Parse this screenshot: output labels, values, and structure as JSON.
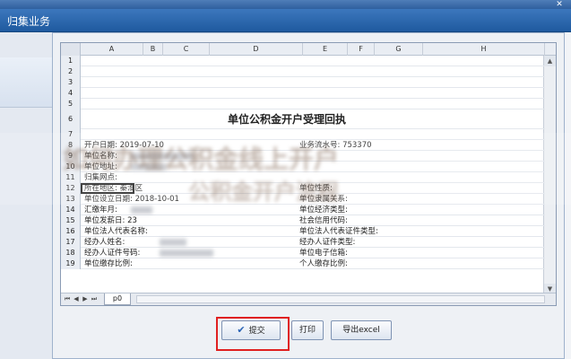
{
  "window": {
    "tab_title": "归集业务"
  },
  "sheet": {
    "columns": [
      "A",
      "B",
      "C",
      "D",
      "E",
      "F",
      "G",
      "H"
    ],
    "row_numbers": [
      "1",
      "2",
      "3",
      "4",
      "5",
      "6",
      "7",
      "8",
      "9",
      "10",
      "11",
      "12",
      "13",
      "14",
      "15",
      "16",
      "17",
      "18",
      "19"
    ],
    "title": "单位公积金开户受理回执",
    "fields": {
      "r8_left": "开户日期:   2019-07-10",
      "r8_right": "业务流水号: 753370",
      "r9_left": "单位名称:",
      "r10_left": "单位地址:",
      "r11_left": "归集网点:",
      "r12_left": "所在地区:   秦淮区",
      "r12_right": "单位性质:",
      "r13_left": "单位设立日期:   2018-10-01",
      "r13_right": "单位隶属关系:",
      "r14_left": "汇缴年月:",
      "r14_right": "单位经济类型:",
      "r15_left": "单位发薪日:   23",
      "r15_right": "社会信用代码:",
      "r16_left": "单位法人代表名称:",
      "r16_right": "单位法人代表证件类型:",
      "r17_left": "经办人姓名:",
      "r17_right": "经办人证件类型:",
      "r18_left": "经办人证件号码:",
      "r18_right": "单位电子信箱:",
      "r19_left": "单位缴存比例:",
      "r19_right": "个人缴存比例:"
    },
    "sheet_tab": "p0"
  },
  "buttons": {
    "submit": "提交",
    "print": "打印",
    "export": "导出excel"
  },
  "overlay": {
    "line1": "如何办理公积金线上开户",
    "line2": "公积金开户流程"
  }
}
